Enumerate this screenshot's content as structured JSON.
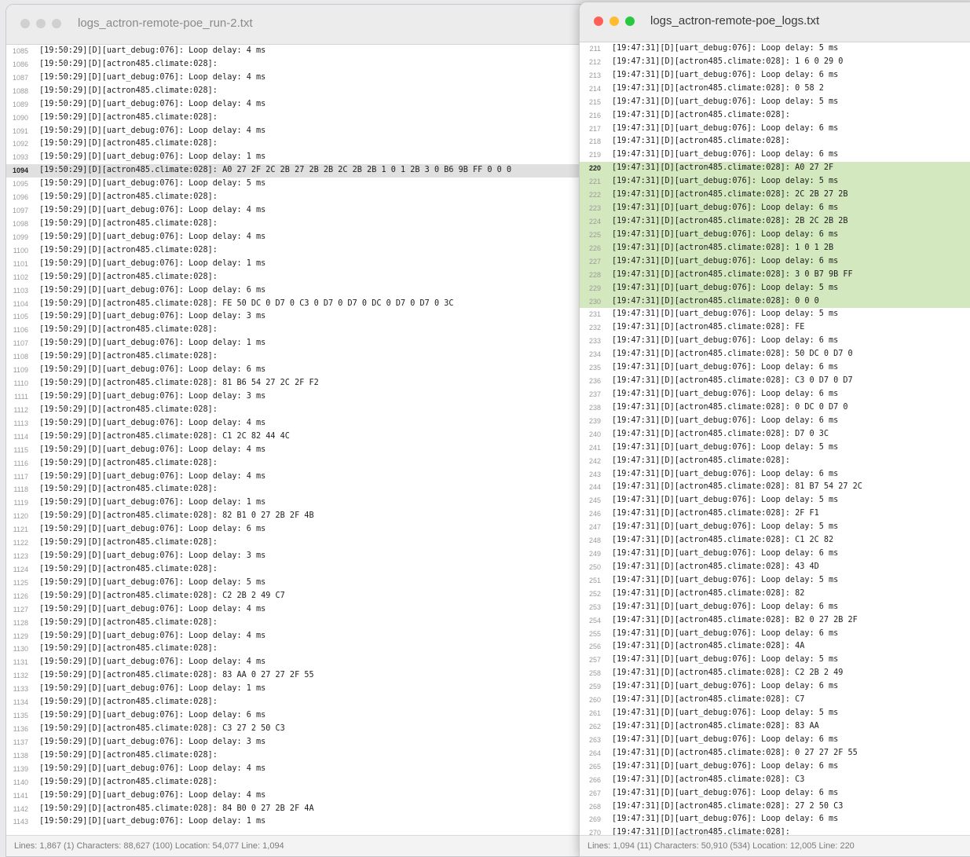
{
  "left_window": {
    "title": "logs_actron-remote-poe_run-2.txt",
    "status": "Lines: 1,867 (1)  Characters: 88,627 (100)  Location: 54,077  Line: 1,094",
    "current_line": 1094,
    "highlight_lines": [],
    "lines": [
      {
        "n": "1085",
        "t": "[19:50:29][D][uart_debug:076]: Loop delay: 4 ms"
      },
      {
        "n": "1086",
        "t": "[19:50:29][D][actron485.climate:028]:"
      },
      {
        "n": "1087",
        "t": "[19:50:29][D][uart_debug:076]: Loop delay: 4 ms"
      },
      {
        "n": "1088",
        "t": "[19:50:29][D][actron485.climate:028]:"
      },
      {
        "n": "1089",
        "t": "[19:50:29][D][uart_debug:076]: Loop delay: 4 ms"
      },
      {
        "n": "1090",
        "t": "[19:50:29][D][actron485.climate:028]:"
      },
      {
        "n": "1091",
        "t": "[19:50:29][D][uart_debug:076]: Loop delay: 4 ms"
      },
      {
        "n": "1092",
        "t": "[19:50:29][D][actron485.climate:028]:"
      },
      {
        "n": "1093",
        "t": "[19:50:29][D][uart_debug:076]: Loop delay: 1 ms"
      },
      {
        "n": "1094",
        "t": "[19:50:29][D][actron485.climate:028]: A0 27 2F 2C 2B 27 2B 2B 2C 2B 2B 1 0 1 2B 3 0 B6 9B FF 0 0 0"
      },
      {
        "n": "1095",
        "t": "[19:50:29][D][uart_debug:076]: Loop delay: 5 ms"
      },
      {
        "n": "1096",
        "t": "[19:50:29][D][actron485.climate:028]:"
      },
      {
        "n": "1097",
        "t": "[19:50:29][D][uart_debug:076]: Loop delay: 4 ms"
      },
      {
        "n": "1098",
        "t": "[19:50:29][D][actron485.climate:028]:"
      },
      {
        "n": "1099",
        "t": "[19:50:29][D][uart_debug:076]: Loop delay: 4 ms"
      },
      {
        "n": "1100",
        "t": "[19:50:29][D][actron485.climate:028]:"
      },
      {
        "n": "1101",
        "t": "[19:50:29][D][uart_debug:076]: Loop delay: 1 ms"
      },
      {
        "n": "1102",
        "t": "[19:50:29][D][actron485.climate:028]:"
      },
      {
        "n": "1103",
        "t": "[19:50:29][D][uart_debug:076]: Loop delay: 6 ms"
      },
      {
        "n": "1104",
        "t": "[19:50:29][D][actron485.climate:028]: FE 50 DC 0 D7 0 C3 0 D7 0 D7 0 DC 0 D7 0 D7 0 3C"
      },
      {
        "n": "1105",
        "t": "[19:50:29][D][uart_debug:076]: Loop delay: 3 ms"
      },
      {
        "n": "1106",
        "t": "[19:50:29][D][actron485.climate:028]:"
      },
      {
        "n": "1107",
        "t": "[19:50:29][D][uart_debug:076]: Loop delay: 1 ms"
      },
      {
        "n": "1108",
        "t": "[19:50:29][D][actron485.climate:028]:"
      },
      {
        "n": "1109",
        "t": "[19:50:29][D][uart_debug:076]: Loop delay: 6 ms"
      },
      {
        "n": "1110",
        "t": "[19:50:29][D][actron485.climate:028]: 81 B6 54 27 2C 2F F2"
      },
      {
        "n": "1111",
        "t": "[19:50:29][D][uart_debug:076]: Loop delay: 3 ms"
      },
      {
        "n": "1112",
        "t": "[19:50:29][D][actron485.climate:028]:"
      },
      {
        "n": "1113",
        "t": "[19:50:29][D][uart_debug:076]: Loop delay: 4 ms"
      },
      {
        "n": "1114",
        "t": "[19:50:29][D][actron485.climate:028]: C1 2C 82 44 4C"
      },
      {
        "n": "1115",
        "t": "[19:50:29][D][uart_debug:076]: Loop delay: 4 ms"
      },
      {
        "n": "1116",
        "t": "[19:50:29][D][actron485.climate:028]:"
      },
      {
        "n": "1117",
        "t": "[19:50:29][D][uart_debug:076]: Loop delay: 4 ms"
      },
      {
        "n": "1118",
        "t": "[19:50:29][D][actron485.climate:028]:"
      },
      {
        "n": "1119",
        "t": "[19:50:29][D][uart_debug:076]: Loop delay: 1 ms"
      },
      {
        "n": "1120",
        "t": "[19:50:29][D][actron485.climate:028]: 82 B1 0 27 2B 2F 4B"
      },
      {
        "n": "1121",
        "t": "[19:50:29][D][uart_debug:076]: Loop delay: 6 ms"
      },
      {
        "n": "1122",
        "t": "[19:50:29][D][actron485.climate:028]:"
      },
      {
        "n": "1123",
        "t": "[19:50:29][D][uart_debug:076]: Loop delay: 3 ms"
      },
      {
        "n": "1124",
        "t": "[19:50:29][D][actron485.climate:028]:"
      },
      {
        "n": "1125",
        "t": "[19:50:29][D][uart_debug:076]: Loop delay: 5 ms"
      },
      {
        "n": "1126",
        "t": "[19:50:29][D][actron485.climate:028]: C2 2B 2 49 C7"
      },
      {
        "n": "1127",
        "t": "[19:50:29][D][uart_debug:076]: Loop delay: 4 ms"
      },
      {
        "n": "1128",
        "t": "[19:50:29][D][actron485.climate:028]:"
      },
      {
        "n": "1129",
        "t": "[19:50:29][D][uart_debug:076]: Loop delay: 4 ms"
      },
      {
        "n": "1130",
        "t": "[19:50:29][D][actron485.climate:028]:"
      },
      {
        "n": "1131",
        "t": "[19:50:29][D][uart_debug:076]: Loop delay: 4 ms"
      },
      {
        "n": "1132",
        "t": "[19:50:29][D][actron485.climate:028]: 83 AA 0 27 27 2F 55"
      },
      {
        "n": "1133",
        "t": "[19:50:29][D][uart_debug:076]: Loop delay: 1 ms"
      },
      {
        "n": "1134",
        "t": "[19:50:29][D][actron485.climate:028]:"
      },
      {
        "n": "1135",
        "t": "[19:50:29][D][uart_debug:076]: Loop delay: 6 ms"
      },
      {
        "n": "1136",
        "t": "[19:50:29][D][actron485.climate:028]: C3 27 2 50 C3"
      },
      {
        "n": "1137",
        "t": "[19:50:29][D][uart_debug:076]: Loop delay: 3 ms"
      },
      {
        "n": "1138",
        "t": "[19:50:29][D][actron485.climate:028]:"
      },
      {
        "n": "1139",
        "t": "[19:50:29][D][uart_debug:076]: Loop delay: 4 ms"
      },
      {
        "n": "1140",
        "t": "[19:50:29][D][actron485.climate:028]:"
      },
      {
        "n": "1141",
        "t": "[19:50:29][D][uart_debug:076]: Loop delay: 4 ms"
      },
      {
        "n": "1142",
        "t": "[19:50:29][D][actron485.climate:028]: 84 B0 0 27 2B 2F 4A"
      },
      {
        "n": "1143",
        "t": "[19:50:29][D][uart_debug:076]: Loop delay: 1 ms"
      }
    ]
  },
  "right_window": {
    "title": "logs_actron-remote-poe_logs.txt",
    "status": "Lines: 1,094 (11)  Characters: 50,910 (534)  Location: 12,005  Line: 220",
    "current_line": 220,
    "highlight_lines": [
      220,
      221,
      222,
      223,
      224,
      225,
      226,
      227,
      228,
      229,
      230
    ],
    "lines": [
      {
        "n": "211",
        "t": "[19:47:31][D][uart_debug:076]: Loop delay: 5 ms"
      },
      {
        "n": "212",
        "t": "[19:47:31][D][actron485.climate:028]: 1 6 0 29 0"
      },
      {
        "n": "213",
        "t": "[19:47:31][D][uart_debug:076]: Loop delay: 6 ms"
      },
      {
        "n": "214",
        "t": "[19:47:31][D][actron485.climate:028]: 0 58 2"
      },
      {
        "n": "215",
        "t": "[19:47:31][D][uart_debug:076]: Loop delay: 5 ms"
      },
      {
        "n": "216",
        "t": "[19:47:31][D][actron485.climate:028]:"
      },
      {
        "n": "217",
        "t": "[19:47:31][D][uart_debug:076]: Loop delay: 6 ms"
      },
      {
        "n": "218",
        "t": "[19:47:31][D][actron485.climate:028]:"
      },
      {
        "n": "219",
        "t": "[19:47:31][D][uart_debug:076]: Loop delay: 6 ms"
      },
      {
        "n": "220",
        "t": "[19:47:31][D][actron485.climate:028]: A0 27 2F"
      },
      {
        "n": "221",
        "t": "[19:47:31][D][uart_debug:076]: Loop delay: 5 ms"
      },
      {
        "n": "222",
        "t": "[19:47:31][D][actron485.climate:028]: 2C 2B 27 2B"
      },
      {
        "n": "223",
        "t": "[19:47:31][D][uart_debug:076]: Loop delay: 6 ms"
      },
      {
        "n": "224",
        "t": "[19:47:31][D][actron485.climate:028]: 2B 2C 2B 2B"
      },
      {
        "n": "225",
        "t": "[19:47:31][D][uart_debug:076]: Loop delay: 6 ms"
      },
      {
        "n": "226",
        "t": "[19:47:31][D][actron485.climate:028]: 1 0 1 2B"
      },
      {
        "n": "227",
        "t": "[19:47:31][D][uart_debug:076]: Loop delay: 6 ms"
      },
      {
        "n": "228",
        "t": "[19:47:31][D][actron485.climate:028]: 3 0 B7 9B FF"
      },
      {
        "n": "229",
        "t": "[19:47:31][D][uart_debug:076]: Loop delay: 5 ms"
      },
      {
        "n": "230",
        "t": "[19:47:31][D][actron485.climate:028]: 0 0 0"
      },
      {
        "n": "231",
        "t": "[19:47:31][D][uart_debug:076]: Loop delay: 5 ms"
      },
      {
        "n": "232",
        "t": "[19:47:31][D][actron485.climate:028]: FE"
      },
      {
        "n": "233",
        "t": "[19:47:31][D][uart_debug:076]: Loop delay: 6 ms"
      },
      {
        "n": "234",
        "t": "[19:47:31][D][actron485.climate:028]: 50 DC 0 D7 0"
      },
      {
        "n": "235",
        "t": "[19:47:31][D][uart_debug:076]: Loop delay: 6 ms"
      },
      {
        "n": "236",
        "t": "[19:47:31][D][actron485.climate:028]: C3 0 D7 0 D7"
      },
      {
        "n": "237",
        "t": "[19:47:31][D][uart_debug:076]: Loop delay: 6 ms"
      },
      {
        "n": "238",
        "t": "[19:47:31][D][actron485.climate:028]: 0 DC 0 D7 0"
      },
      {
        "n": "239",
        "t": "[19:47:31][D][uart_debug:076]: Loop delay: 6 ms"
      },
      {
        "n": "240",
        "t": "[19:47:31][D][actron485.climate:028]: D7 0 3C"
      },
      {
        "n": "241",
        "t": "[19:47:31][D][uart_debug:076]: Loop delay: 5 ms"
      },
      {
        "n": "242",
        "t": "[19:47:31][D][actron485.climate:028]:"
      },
      {
        "n": "243",
        "t": "[19:47:31][D][uart_debug:076]: Loop delay: 6 ms"
      },
      {
        "n": "244",
        "t": "[19:47:31][D][actron485.climate:028]: 81 B7 54 27 2C"
      },
      {
        "n": "245",
        "t": "[19:47:31][D][uart_debug:076]: Loop delay: 5 ms"
      },
      {
        "n": "246",
        "t": "[19:47:31][D][actron485.climate:028]: 2F F1"
      },
      {
        "n": "247",
        "t": "[19:47:31][D][uart_debug:076]: Loop delay: 5 ms"
      },
      {
        "n": "248",
        "t": "[19:47:31][D][actron485.climate:028]: C1 2C 82"
      },
      {
        "n": "249",
        "t": "[19:47:31][D][uart_debug:076]: Loop delay: 6 ms"
      },
      {
        "n": "250",
        "t": "[19:47:31][D][actron485.climate:028]: 43 4D"
      },
      {
        "n": "251",
        "t": "[19:47:31][D][uart_debug:076]: Loop delay: 5 ms"
      },
      {
        "n": "252",
        "t": "[19:47:31][D][actron485.climate:028]: 82"
      },
      {
        "n": "253",
        "t": "[19:47:31][D][uart_debug:076]: Loop delay: 6 ms"
      },
      {
        "n": "254",
        "t": "[19:47:31][D][actron485.climate:028]: B2 0 27 2B 2F"
      },
      {
        "n": "255",
        "t": "[19:47:31][D][uart_debug:076]: Loop delay: 6 ms"
      },
      {
        "n": "256",
        "t": "[19:47:31][D][actron485.climate:028]: 4A"
      },
      {
        "n": "257",
        "t": "[19:47:31][D][uart_debug:076]: Loop delay: 5 ms"
      },
      {
        "n": "258",
        "t": "[19:47:31][D][actron485.climate:028]: C2 2B 2 49"
      },
      {
        "n": "259",
        "t": "[19:47:31][D][uart_debug:076]: Loop delay: 6 ms"
      },
      {
        "n": "260",
        "t": "[19:47:31][D][actron485.climate:028]: C7"
      },
      {
        "n": "261",
        "t": "[19:47:31][D][uart_debug:076]: Loop delay: 5 ms"
      },
      {
        "n": "262",
        "t": "[19:47:31][D][actron485.climate:028]: 83 AA"
      },
      {
        "n": "263",
        "t": "[19:47:31][D][uart_debug:076]: Loop delay: 6 ms"
      },
      {
        "n": "264",
        "t": "[19:47:31][D][actron485.climate:028]: 0 27 27 2F 55"
      },
      {
        "n": "265",
        "t": "[19:47:31][D][uart_debug:076]: Loop delay: 6 ms"
      },
      {
        "n": "266",
        "t": "[19:47:31][D][actron485.climate:028]: C3"
      },
      {
        "n": "267",
        "t": "[19:47:31][D][uart_debug:076]: Loop delay: 6 ms"
      },
      {
        "n": "268",
        "t": "[19:47:31][D][actron485.climate:028]: 27 2 50 C3"
      },
      {
        "n": "269",
        "t": "[19:47:31][D][uart_debug:076]: Loop delay: 6 ms"
      },
      {
        "n": "270",
        "t": "[19:47:31][D][actron485.climate:028]:"
      }
    ]
  },
  "colors": {
    "traffic_inactive": "#d0d0d0",
    "traffic_close": "#ff5f57",
    "traffic_minimize": "#febc2e",
    "traffic_zoom": "#28c840",
    "current_line_bg": "#e0e0e0",
    "highlight_bg": "#d3e8be"
  }
}
